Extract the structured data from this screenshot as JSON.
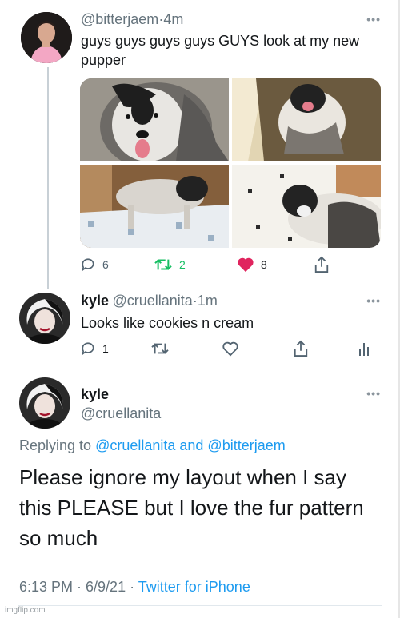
{
  "tweet1": {
    "handle": "@bitterjaem",
    "time": "4m",
    "text": "guys guys guys guys GUYS look at my new pupper",
    "photos": [
      "dog-photo-closeup",
      "dog-photo-on-floor",
      "dog-photo-kitchen",
      "dog-photo-lying"
    ],
    "replies": "6",
    "retweets": "2",
    "likes": "8",
    "retweet_color": "#17bf63",
    "like_color": "#e0245e"
  },
  "tweet2": {
    "name": "kyle",
    "handle": "@cruellanita",
    "time": "1m",
    "text": "Looks like cookies n cream",
    "replies": "1"
  },
  "tweet3": {
    "name": "kyle",
    "handle": "@cruellanita",
    "replying_label": "Replying to",
    "replying_mentions": "@cruellanita and @bitterjaem",
    "text_line1": "Please ignore my layout when I say",
    "text_line2": "this PLEASE but I love the fur pattern",
    "text_line3": "so much",
    "timestamp": "6:13 PM · 6/9/21 ·",
    "source": "Twitter for iPhone"
  },
  "more_glyph": "•••",
  "separator": "·",
  "watermark": "imgflip.com",
  "accent_color": "#1d9bf0"
}
